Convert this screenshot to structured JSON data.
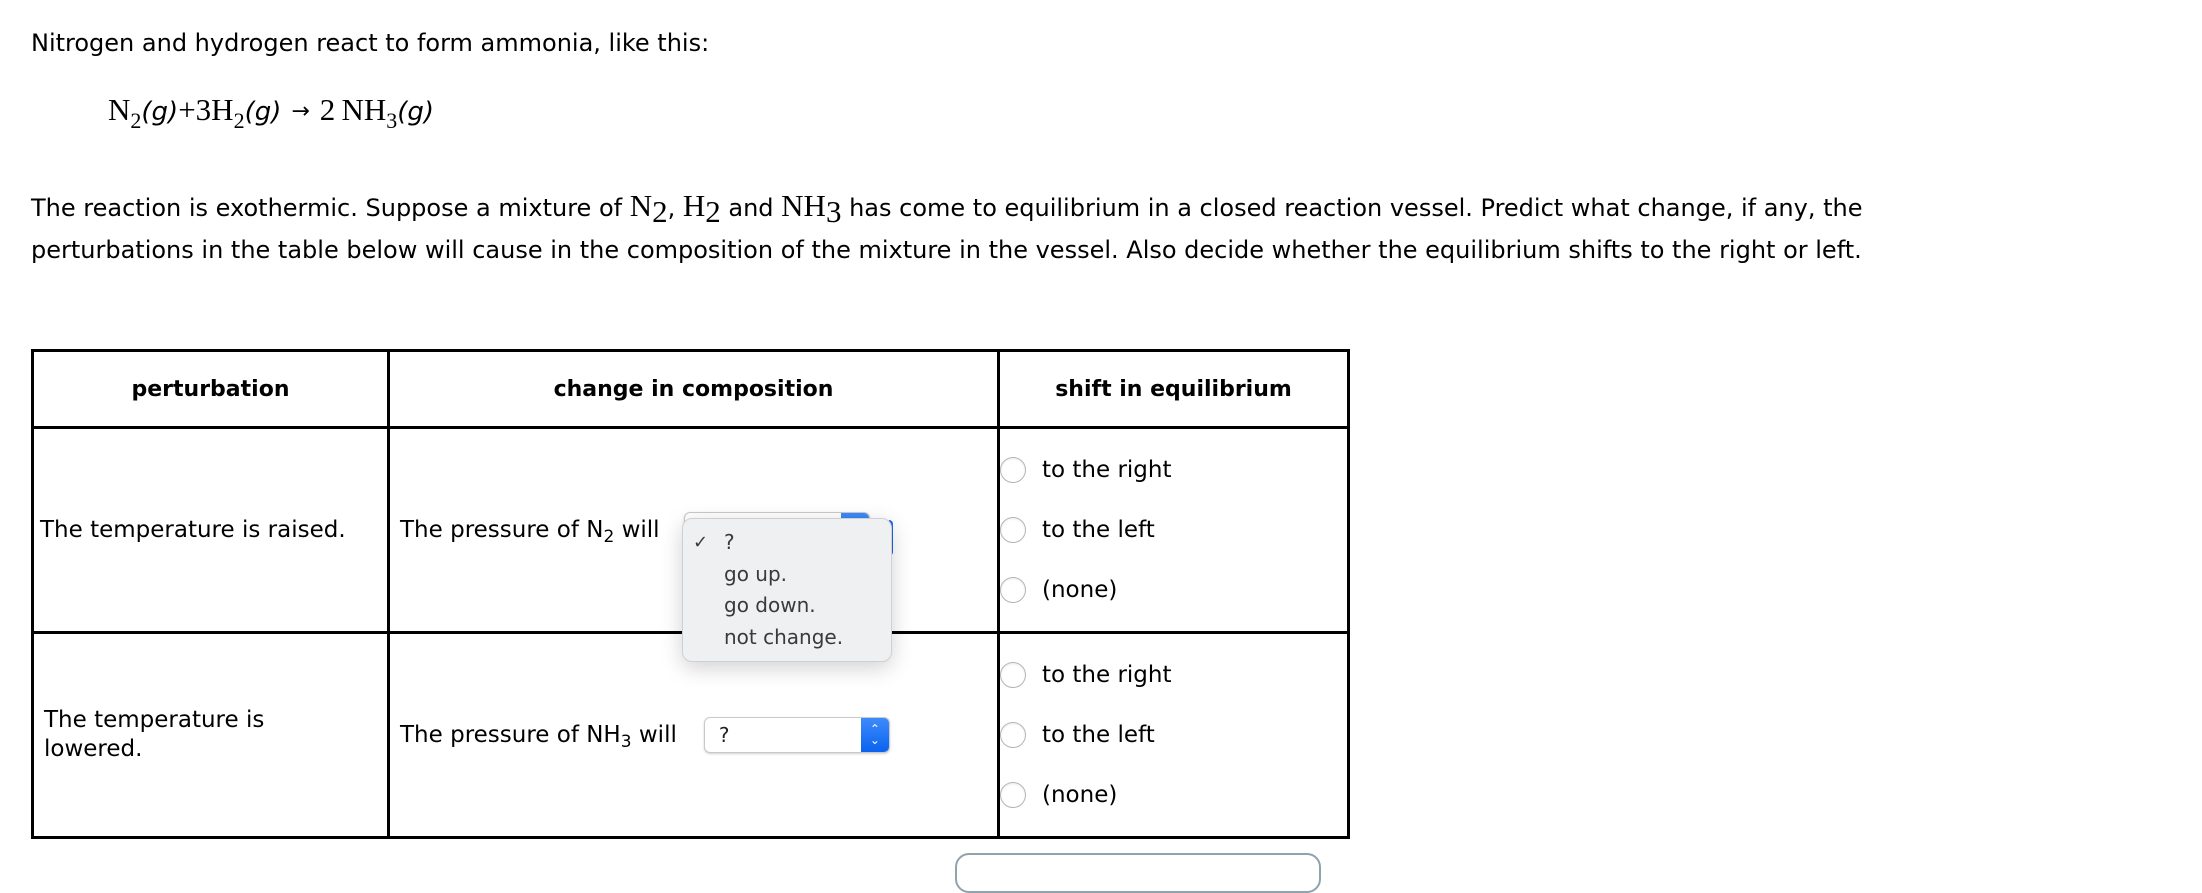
{
  "intro_text": "Nitrogen and hydrogen react to form ammonia, like this:",
  "equation": {
    "reactant1": "N",
    "reactant1_sub": "2",
    "reactant1_state": "(g)",
    "plus": "+",
    "coef2": "3",
    "reactant2": "H",
    "reactant2_sub": "2",
    "reactant2_state": "(g)",
    "arrow": "→",
    "coef3": "2",
    "product": "NH",
    "product_sub": "3",
    "product_state": "(g)"
  },
  "paragraph": {
    "line1_a": "The reaction is exothermic. Suppose a mixture of ",
    "n2": "N",
    "n2_sub": "2",
    "comma": ", ",
    "h2": "H",
    "h2_sub": "2",
    "and": " and ",
    "nh3": "NH",
    "nh3_sub": "3",
    "line1_b": " has come to equilibrium in a closed reaction vessel. Predict what change, if any, the",
    "line2": "perturbations in the table below will cause in the composition of the mixture in the vessel. Also decide whether the equilibrium shifts to the right or left."
  },
  "table": {
    "headers": [
      "perturbation",
      "change in composition",
      "shift in equilibrium"
    ],
    "rows": [
      {
        "perturbation": "The temperature is raised.",
        "composition_prefix": "The pressure of N",
        "composition_sub": "2",
        "composition_suffix": " will",
        "select_value": "?",
        "shift_options": [
          "to the right",
          "to the left",
          "(none)"
        ]
      },
      {
        "perturbation": "The temperature is lowered.",
        "composition_prefix": "The pressure of NH",
        "composition_sub": "3",
        "composition_suffix": " will",
        "select_value": "?",
        "shift_options": [
          "to the right",
          "to the left",
          "(none)"
        ]
      }
    ]
  },
  "dropdown": {
    "open_for_row": 1,
    "check_icon": "✓",
    "selected": "?",
    "options": [
      "?",
      "go up.",
      "go down.",
      "not change."
    ]
  },
  "colors": {
    "accent_blue": "#0a62f0",
    "menu_bg": "#eff0f2"
  }
}
